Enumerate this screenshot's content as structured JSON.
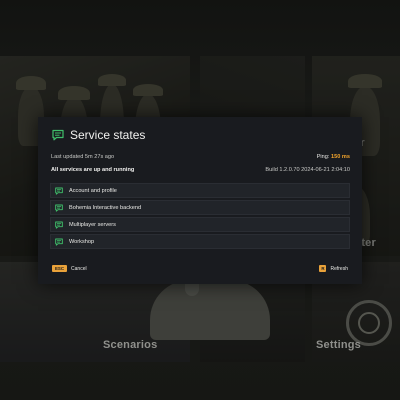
{
  "background": {
    "tiles": {
      "scenarios": "Scenarios",
      "settings": "Settings",
      "partial_top": "er",
      "partial_mid": "ster"
    }
  },
  "dialog": {
    "title": "Service states",
    "icon": "message-icon",
    "last_updated": "Last updated 5m 27s ago",
    "status_summary": "All services are up and running",
    "ping_label": "Ping:",
    "ping_value": "150 ms",
    "build": "Build 1.2.0.70 2024-06-21 2:04:10",
    "services": [
      {
        "label": "Account and profile",
        "status": "ok"
      },
      {
        "label": "Bohemia Interactive backend",
        "status": "ok"
      },
      {
        "label": "Multiplayer servers",
        "status": "ok"
      },
      {
        "label": "Workshop",
        "status": "ok"
      }
    ],
    "footer": {
      "cancel_key": "ESC",
      "cancel_label": "Cancel",
      "refresh_key": "R",
      "refresh_label": "Refresh"
    }
  },
  "colors": {
    "accent_ok": "#3fbf6a",
    "accent_key": "#e9a23a",
    "ping": "#f2a42c",
    "dialog_bg": "#191b1f"
  }
}
